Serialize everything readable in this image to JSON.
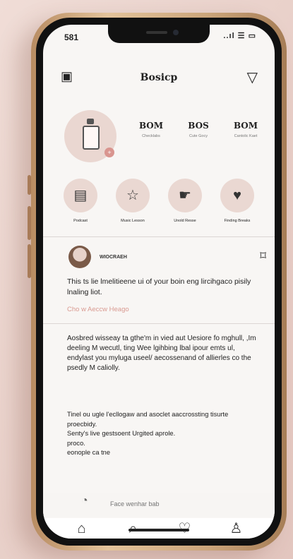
{
  "status": {
    "time": "581",
    "icons": "..ıl ☰ ▭"
  },
  "header": {
    "title": "Bosicp"
  },
  "profile": {
    "stats": [
      {
        "value": "BOM",
        "label": "Checklabs"
      },
      {
        "value": "BOS",
        "label": "Cute Gocy"
      },
      {
        "value": "BOM",
        "label": "Cantolic Kaet"
      }
    ]
  },
  "highlights": [
    {
      "label": "Podcast"
    },
    {
      "label": "Music Lesson"
    },
    {
      "label": "Unold Resse"
    },
    {
      "label": "Finding Breaks"
    }
  ],
  "post": {
    "username": "WIOCRAEH",
    "headline": "This ts lie lmelitieene ui of your boin eng lircihgaco pisily lnaling liot.",
    "link": "Cho w Aeccw Heago",
    "paragraph_1": "Aosbred wisseay ta gthe'm in vied aut Uesiore fo mghull, ,Im deeling M wecutl, ting Wee lgihbing lbal ipour emts ul, endylast you myluga useel/ aecossenand of allierles co the psedly M caliolly.",
    "paragraph_2": "Tinel ou ugle l'ecllogaw and asoclet aaccrossting tisurte proecbidy.\nSenty's live gestsoent Urgited aprole.\nproco.\neonople ca tne"
  },
  "comment": {
    "placeholder": "Face wenhar bab"
  }
}
